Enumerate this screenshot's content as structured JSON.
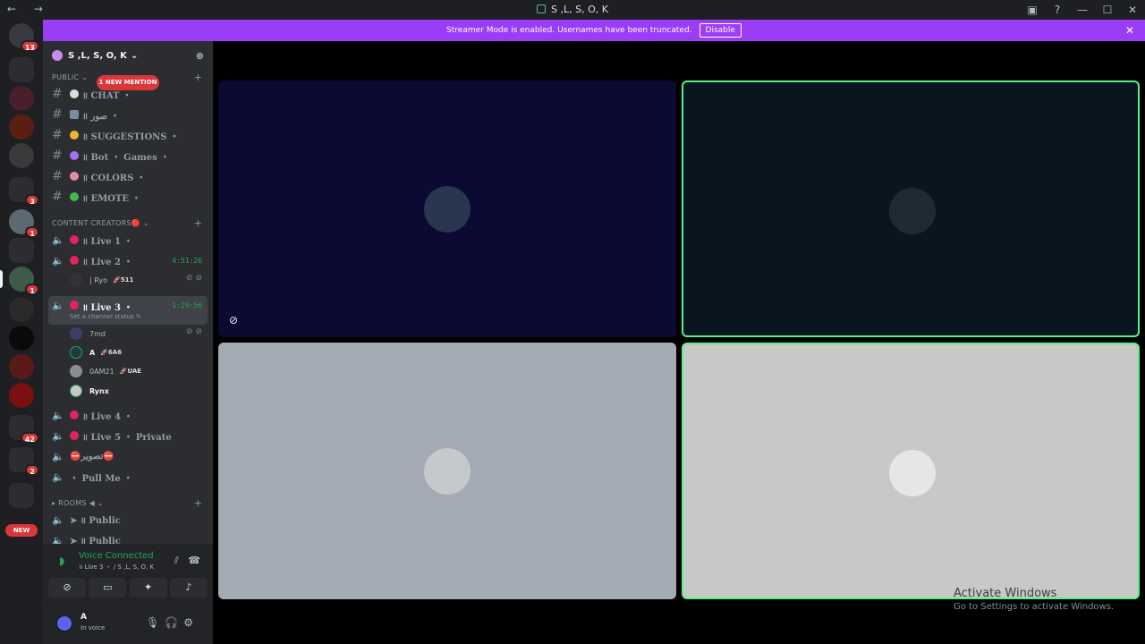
{
  "window": {
    "title": "S ,L, S, O, K",
    "nav": "← →",
    "controls": [
      "▣",
      "?",
      "—",
      "☐",
      "✕"
    ]
  },
  "guilds": {
    "dm_badge": "13",
    "badges": [
      "3",
      "1",
      "1",
      "42",
      "2"
    ],
    "new_label": "NEW"
  },
  "banner": {
    "text": "Streamer Mode is enabled. Usernames have been truncated.",
    "button": "Disable",
    "close": "✕"
  },
  "server": {
    "name": "S ,L, S, O, K",
    "chevron": "⌄",
    "invite_icon": "person-add-icon"
  },
  "mention_pill": "1 NEW MENTION",
  "categories": {
    "public": "PUBLIC ⌄",
    "creators": "CONTENT CREATORS🔴 ⌄",
    "rooms": "▸ ROOMS ◀ ⌄"
  },
  "text_channels": [
    {
      "label": "॥ CHAT ・",
      "emoji_color": "#dbdee1"
    },
    {
      "label": "॥ صور ・",
      "emoji_color": "#7a8ca3"
    },
    {
      "label": "॥ SUGGESTIONS ・",
      "emoji_color": "#f0b232"
    },
    {
      "label": "॥ Bot ・ Games ・",
      "emoji_color": "#a371f7"
    },
    {
      "label": "॥ COLORS ・",
      "emoji_color": "#e88ba0"
    },
    {
      "label": "॥ EMOTE ・",
      "emoji_color": "#3fb950"
    }
  ],
  "voice_channels": [
    {
      "label": "॥ Live 1 ・"
    },
    {
      "label": "॥ Live 2 ・",
      "timer": "4:51:26"
    },
    {
      "label": "॥ Live 3 ・",
      "timer": "1:29:56"
    },
    {
      "label": "॥ Live 4 ・"
    },
    {
      "label": "॥ Live 5 ・ Private"
    },
    {
      "label": "⛔تصوير⛔"
    },
    {
      "label": "・ Pull Me ・"
    }
  ],
  "live2_users": [
    {
      "name": "| Ryo",
      "tag": "🚀511"
    }
  ],
  "live3_status": "Set a channel status ✎",
  "live3_users": [
    {
      "name": "7md",
      "tag": ""
    },
    {
      "name": "A",
      "tag": "🚀6A6"
    },
    {
      "name": "0AM21",
      "tag": "🚀UAE"
    },
    {
      "name": "Rynx",
      "tag": ""
    }
  ],
  "rooms_channels": [
    {
      "label": "➤ ॥ Public"
    },
    {
      "label": "➤ ॥ Public"
    }
  ],
  "voice_panel": {
    "title": "Voice Connected",
    "subtitle": "॥ Live 3 ・ / S ,L, S, O, K",
    "buttons": [
      "camera-off-icon",
      "screen-share-icon",
      "activities-icon",
      "soundboard-icon"
    ]
  },
  "user_panel": {
    "name": "A",
    "status": "In voice"
  },
  "tiles": [
    {
      "bg": "#0b0a33",
      "border": "none"
    },
    {
      "bg": "#0b1520",
      "border": "#57f287"
    },
    {
      "bg": "#a3aab3",
      "border": "none"
    },
    {
      "bg": "#c8c9c6",
      "border": "#57f287"
    }
  ],
  "watermark": {
    "line1": "Activate Windows",
    "line2": "Go to Settings to activate Windows."
  }
}
